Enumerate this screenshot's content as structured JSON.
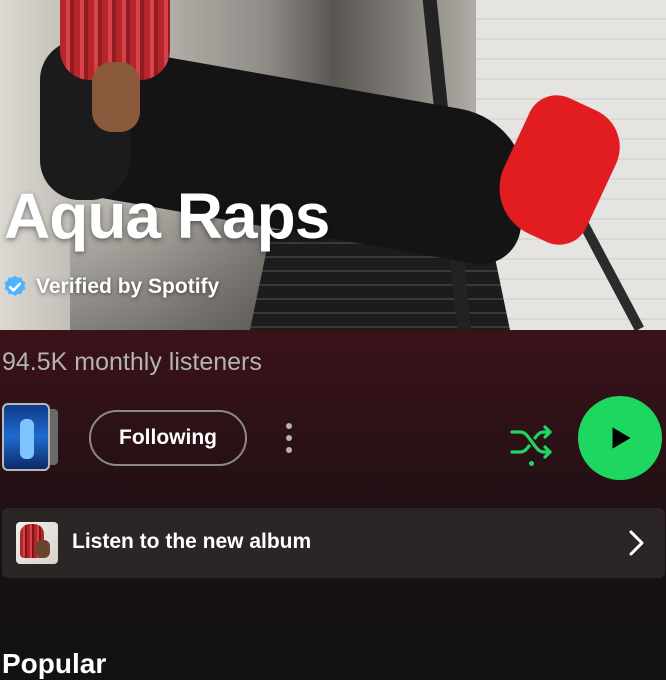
{
  "artist": {
    "name": "Aqua Raps",
    "verified_label": "Verified by Spotify",
    "monthly_listeners": "94.5K monthly listeners"
  },
  "actions": {
    "follow_label": "Following"
  },
  "promo": {
    "label": "Listen to the new album"
  },
  "sections": {
    "popular_title": "Popular"
  },
  "colors": {
    "accent": "#1ed760",
    "background": "#121212",
    "hero_tint": "#3a1319",
    "card": "#2b2526"
  },
  "icons": {
    "verified": "verified-badge-icon",
    "more": "more-options-icon",
    "shuffle": "shuffle-icon",
    "play": "play-icon",
    "chevron": "chevron-right-icon"
  }
}
